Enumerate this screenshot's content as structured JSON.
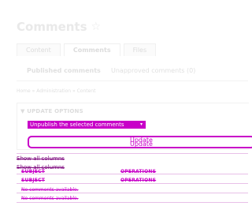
{
  "header": {
    "title": "Comments",
    "star_icon": "star-outline-icon"
  },
  "tabs": [
    {
      "label": "Content",
      "active": false
    },
    {
      "label": "Comments",
      "active": true
    },
    {
      "label": "Files",
      "active": false
    }
  ],
  "subtabs": {
    "published": "Published comments",
    "unapproved": "Unapproved comments (0)"
  },
  "breadcrumb": "Home » Administration » Content",
  "update_options": {
    "summary": "▼ UPDATE OPTIONS",
    "action_selected": "Unpublish the selected comments",
    "update_label": "Update",
    "update_label_dup": "Update",
    "accent_color": "#c800c8"
  },
  "show_columns": {
    "label": "Show all columns",
    "label_dup": "Show all columns"
  },
  "table": {
    "headers": [
      "SUBJECT",
      "OPERATIONS"
    ],
    "headers_dup": [
      "SUBJECT",
      "OPERATIONS"
    ],
    "empty_text": "No comments available.",
    "empty_text_dup": "No comments available."
  }
}
